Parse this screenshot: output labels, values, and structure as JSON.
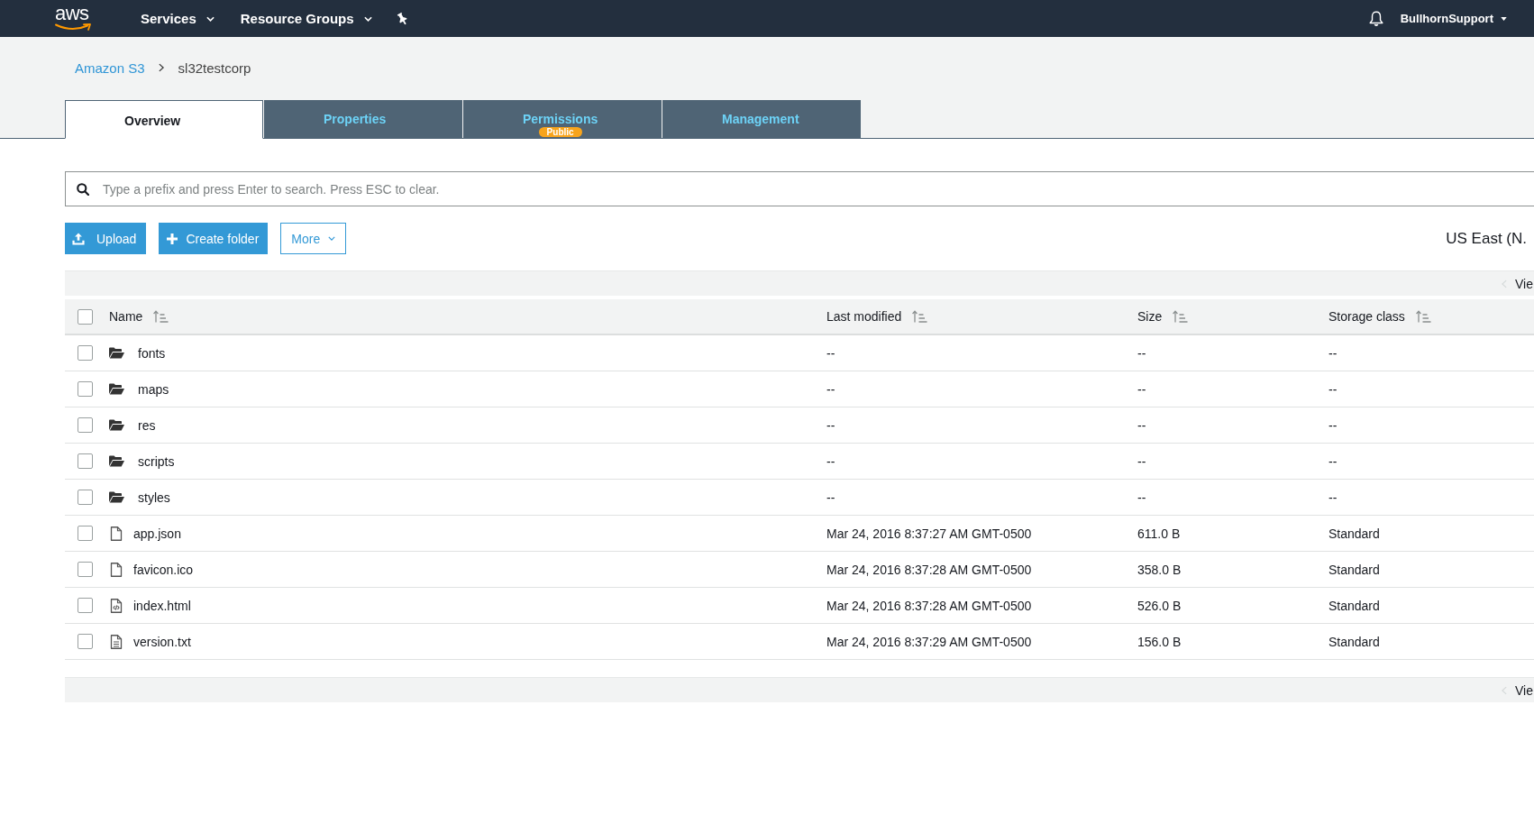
{
  "top_bar": {
    "logo": "aws",
    "menus": [
      {
        "label": "Services"
      },
      {
        "label": "Resource Groups"
      }
    ],
    "user": "BullhornSupport"
  },
  "breadcrumb": [
    "Amazon S3",
    "sl32testcorp"
  ],
  "tabs": [
    {
      "label": "Overview",
      "selected": true
    },
    {
      "label": "Properties",
      "selected": false
    },
    {
      "label": "Permissions",
      "selected": false,
      "badge": "Public"
    },
    {
      "label": "Management",
      "selected": false
    }
  ],
  "search": {
    "placeholder": "Type a prefix and press Enter to search. Press ESC to clear."
  },
  "actions": [
    {
      "label": "Upload",
      "kind": "upload"
    },
    {
      "label": "Create folder",
      "kind": "create"
    },
    {
      "label": "More",
      "kind": "menu"
    }
  ],
  "region": "US East (N.",
  "pager_top": "Vie",
  "table": {
    "select_all": {
      "checked": false
    },
    "columns": [
      "Name",
      "Last modified",
      "Size",
      "Storage class"
    ],
    "rows": [
      {
        "name": "fonts",
        "kind": "folder",
        "last_modified": "--",
        "size": "--",
        "storage_class": "--",
        "checked": false
      },
      {
        "name": "maps",
        "kind": "folder",
        "last_modified": "--",
        "size": "--",
        "storage_class": "--",
        "checked": false
      },
      {
        "name": "res",
        "kind": "folder",
        "last_modified": "--",
        "size": "--",
        "storage_class": "--",
        "checked": false
      },
      {
        "name": "scripts",
        "kind": "folder",
        "last_modified": "--",
        "size": "--",
        "storage_class": "--",
        "checked": false
      },
      {
        "name": "styles",
        "kind": "folder",
        "last_modified": "--",
        "size": "--",
        "storage_class": "--",
        "checked": false
      },
      {
        "name": "app.json",
        "kind": "file",
        "last_modified": "Mar 24, 2016 8:37:27 AM GMT-0500",
        "size": "611.0 B",
        "storage_class": "Standard",
        "checked": false
      },
      {
        "name": "favicon.ico",
        "kind": "file",
        "last_modified": "Mar 24, 2016 8:37:28 AM GMT-0500",
        "size": "358.0 B",
        "storage_class": "Standard",
        "checked": false
      },
      {
        "name": "index.html",
        "kind": "code",
        "last_modified": "Mar 24, 2016 8:37:28 AM GMT-0500",
        "size": "526.0 B",
        "storage_class": "Standard",
        "checked": false
      },
      {
        "name": "version.txt",
        "kind": "text",
        "last_modified": "Mar 24, 2016 8:37:29 AM GMT-0500",
        "size": "156.0 B",
        "storage_class": "Standard",
        "checked": false
      }
    ]
  },
  "pager_bottom": "Vie"
}
